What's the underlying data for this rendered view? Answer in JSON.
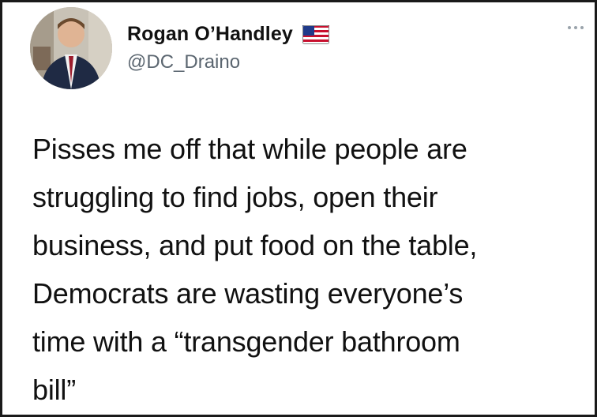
{
  "author": {
    "display_name": "Rogan O’Handley",
    "handle": "@DC_Draino",
    "flag_icon": "us-flag-emoji"
  },
  "tweet": {
    "text": "Pisses me off that while people are\nstruggling to find jobs, open their\nbusiness, and put food on the table,\nDemocrats are wasting everyone’s\ntime with a “transgender bathroom\nbill”"
  },
  "menu": {
    "icon": "more-options-icon"
  },
  "colors": {
    "text": "#111111",
    "handle": "#5b6670",
    "border": "#1a1a1a"
  }
}
